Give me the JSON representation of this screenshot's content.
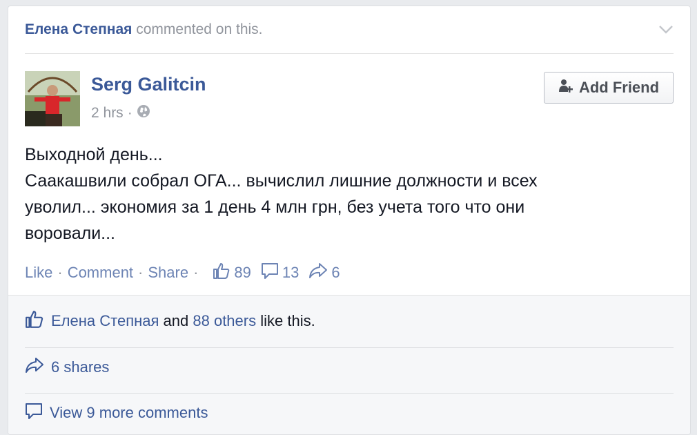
{
  "context": {
    "actor": "Елена Степная",
    "action": "commented on this."
  },
  "post": {
    "author": "Serg Galitcin",
    "time": "2 hrs",
    "meta_sep": "·",
    "add_friend_label": "Add Friend",
    "text_lines": [
      "Выходной день...",
      "Саакашвили собрал ОГА... вычислил лишние должности и всех",
      "уволил... экономия за 1 день 4 млн грн, без учета того что они",
      "воровали..."
    ]
  },
  "actions": {
    "like": "Like",
    "comment": "Comment",
    "share": "Share",
    "sep": "·",
    "likes_count": "89",
    "comments_count": "13",
    "shares_count": "6"
  },
  "feedback": {
    "likers_name": "Елена Степная",
    "likers_and": "and",
    "likers_others": "88 others",
    "likers_suffix": "like this.",
    "shares": "6 shares",
    "more_comments": "View 9 more comments"
  },
  "colors": {
    "link": "#3b5998",
    "muted": "#90949c",
    "action": "#6d84b4"
  }
}
